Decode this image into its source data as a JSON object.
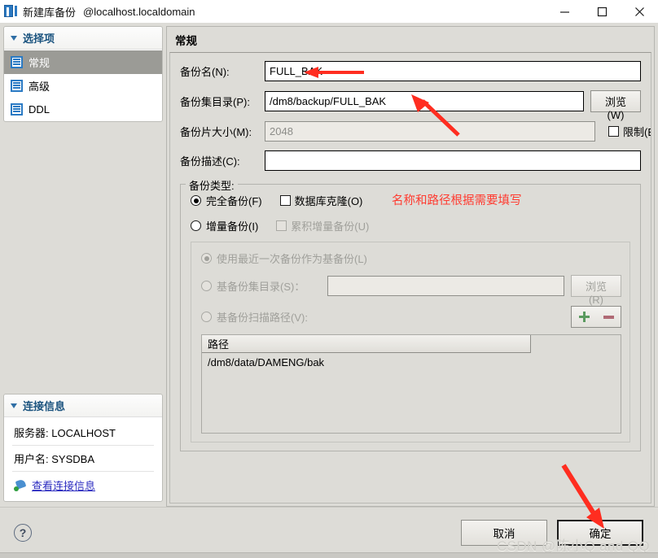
{
  "window": {
    "title": "新建库备份",
    "host": "@localhost.localdomain",
    "icon": "database-backup-icon",
    "controls": {
      "minimize": "minimize-icon",
      "maximize": "maximize-icon",
      "close": "close-icon"
    }
  },
  "sidebar": {
    "options_panel": {
      "title": "选择项",
      "items": [
        {
          "label": "常规",
          "selected": true
        },
        {
          "label": "高级",
          "selected": false
        },
        {
          "label": "DDL",
          "selected": false
        }
      ]
    },
    "connection_panel": {
      "title": "连接信息",
      "server_label": "服务器:",
      "server_value": "LOCALHOST",
      "user_label": "用户名:",
      "user_value": "SYSDBA",
      "link_text": "查看连接信息"
    }
  },
  "main": {
    "section_title": "常规",
    "fields": {
      "backup_name": {
        "label": "备份名(N):",
        "value": "FULL_BAK",
        "placeholder": ""
      },
      "backup_dir": {
        "label": "备份集目录(P):",
        "value": "/dm8/backup/FULL_BAK",
        "placeholder": "",
        "browse_label": "浏览(W)"
      },
      "piece_size": {
        "label": "备份片大小(M):",
        "value": "2048",
        "limit_label": "限制(E)",
        "limit_checked": false
      },
      "description": {
        "label": "备份描述(C):",
        "value": "",
        "placeholder": ""
      }
    },
    "backup_type": {
      "legend": "备份类型:",
      "full_label": "完全备份(F)",
      "full_selected": true,
      "clone_label": "数据库克隆(O)",
      "clone_checked": false,
      "incremental_label": "增量备份(I)",
      "incremental_selected": false,
      "cumulative_label": "累积增量备份(U)",
      "cumulative_checked": false,
      "base_group": {
        "use_last_label": "使用最近一次备份作为基备份(L)",
        "use_last_selected": true,
        "base_dir_label": "基备份集目录(S)：",
        "base_dir_value": "",
        "base_browse_label": "浏览(R)",
        "scan_path_label": "基备份扫描路径(V):",
        "add_icon": "plus-icon",
        "remove_icon": "minus-icon",
        "table": {
          "header": "路径",
          "rows": [
            "/dm8/data/DAMENG/bak"
          ]
        }
      }
    },
    "annotation": "名称和路径根据需要填写"
  },
  "footer": {
    "help_icon": "help-icon",
    "cancel_label": "取消",
    "ok_label": "确定",
    "watermark": "CSDN @陈小Q and QQ"
  },
  "colors": {
    "window_bg": "#dddcd7",
    "selection": "#9b9b96",
    "accent_link": "#2c2cc0",
    "panel_title": "#19527e",
    "annotation": "#ff3b30"
  }
}
